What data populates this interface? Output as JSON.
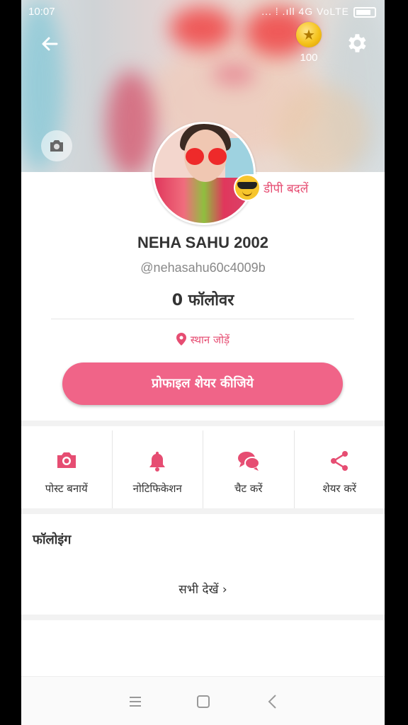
{
  "status": {
    "time": "10:07",
    "indicators": "... ⁞ .ıll 4G VoLTE"
  },
  "header": {
    "coins": "100"
  },
  "profile": {
    "dp_change_label": "डीपी बदलें",
    "name": "NEHA SAHU 2002",
    "handle": "@nehasahu60c4009b",
    "followers": "0 फॉलोवर",
    "location_label": "स्थान जोड़ें",
    "share_profile_label": "प्रोफाइल शेयर कीजिये"
  },
  "actions": [
    {
      "label": "पोस्ट बनायें",
      "icon": "camera-icon"
    },
    {
      "label": "नोटिफिकेशन",
      "icon": "bell-icon"
    },
    {
      "label": "चैट करें",
      "icon": "chat-icon"
    },
    {
      "label": "शेयर करें",
      "icon": "share-icon"
    }
  ],
  "following": {
    "title": "फॉलोइंग",
    "see_all": "सभी देखें"
  },
  "colors": {
    "accent": "#f06488",
    "accent_text": "#e64d72"
  }
}
